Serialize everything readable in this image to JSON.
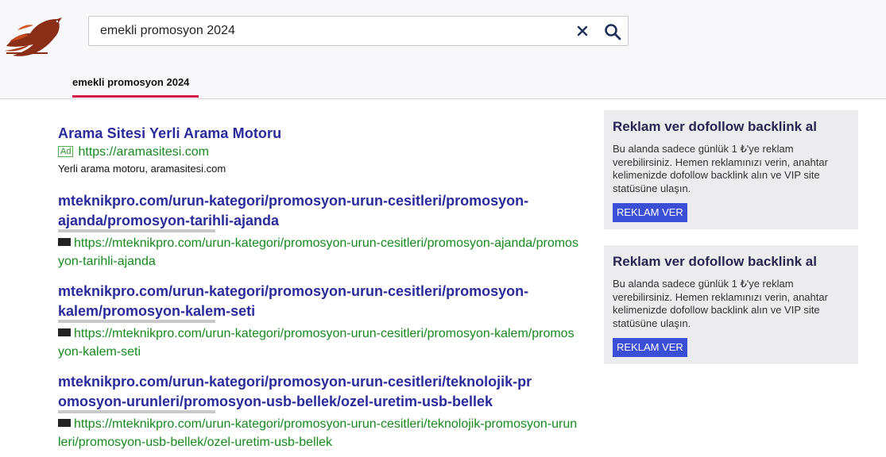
{
  "header": {
    "search": {
      "value": "emekli promosyon 2024",
      "clear_icon": "close-icon",
      "submit_icon": "search-icon"
    },
    "tabs": [
      {
        "label": "emekli promosyon 2024",
        "active": true
      }
    ],
    "accent_color": "#d4194a"
  },
  "ad_result": {
    "title": "Arama Sitesi Yerli Arama Motoru",
    "badge": "Ad",
    "url": "https://aramasitesi.com",
    "description": "Yerli arama motoru, aramasitesi.com"
  },
  "results": [
    {
      "title": "mteknikpro.com/urun-kategori/promosyon-urun-cesitleri/promosyon-ajanda/promosyon-tarihli-ajanda",
      "url": "https://mteknikpro.com/urun-kategori/promosyon-urun-cesitleri/promosyon-ajanda/promosyon-tarihli-ajanda"
    },
    {
      "title": "mteknikpro.com/urun-kategori/promosyon-urun-cesitleri/promosyon-kalem/promosyon-kalem-seti",
      "url": "https://mteknikpro.com/urun-kategori/promosyon-urun-cesitleri/promosyon-kalem/promosyon-kalem-seti"
    },
    {
      "title": "mteknikpro.com/urun-kategori/promosyon-urun-cesitleri/teknolojik-promosyon-urunleri/promosyon-usb-bellek/ozel-uretim-usb-bellek",
      "url": "https://mteknikpro.com/urun-kategori/promosyon-urun-cesitleri/teknolojik-promosyon-urunleri/promosyon-usb-bellek/ozel-uretim-usb-bellek"
    }
  ],
  "sidebar_ads": [
    {
      "title": "Reklam ver dofollow backlink al",
      "text": "Bu alanda sadece günlük 1 ₺'ye reklam verebilirsiniz. Hemen reklamınızı verin, anahtar kelimenizde dofollow backlink alın ve VIP site statüsüne ulaşın.",
      "button": "REKLAM VER"
    },
    {
      "title": "Reklam ver dofollow backlink al",
      "text": "Bu alanda sadece günlük 1 ₺'ye reklam verebilirsiniz. Hemen reklamınızı verin, anahtar kelimenizde dofollow backlink alın ve VIP site statüsüne ulaşın.",
      "button": "REKLAM VER"
    }
  ],
  "colors": {
    "link": "#2a2a9c",
    "url": "#168a1e",
    "button": "#3b4fd6"
  }
}
